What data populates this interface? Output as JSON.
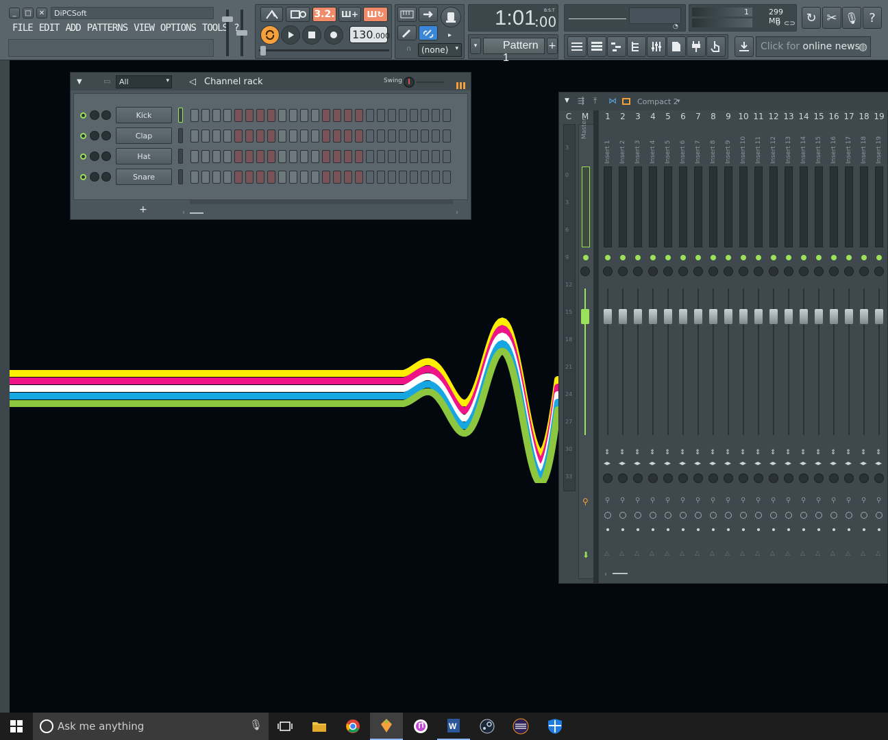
{
  "window": {
    "title": "DiPCSoft",
    "controls": [
      "_",
      "□",
      "✕"
    ]
  },
  "menu": [
    "FILE",
    "EDIT",
    "ADD",
    "PATTERNS",
    "VIEW",
    "OPTIONS",
    "TOOLS",
    "?"
  ],
  "transport": {
    "tempo": "130",
    "tempo_decimals": ".000",
    "time": "1:01",
    "time_ticks": ":00",
    "time_label": "B:S:T",
    "snap": "(none)",
    "pattern": "Pattern 1"
  },
  "cpu": {
    "voices": "1",
    "memory": "299 MB",
    "polyphony": "0"
  },
  "news": {
    "text_prefix": "Click for ",
    "text_highlight": "online news"
  },
  "channel_rack": {
    "title": "Channel rack",
    "filter": "All",
    "swing_label": "Swing",
    "add_label": "+",
    "channels": [
      {
        "name": "Kick"
      },
      {
        "name": "Clap"
      },
      {
        "name": "Hat"
      },
      {
        "name": "Snare"
      }
    ]
  },
  "mixer": {
    "preset": "Compact 2",
    "master_label": "Master",
    "c_label": "C",
    "m_label": "M",
    "tracks": [
      "1",
      "2",
      "3",
      "4",
      "5",
      "6",
      "7",
      "8",
      "9",
      "10",
      "11",
      "12",
      "13",
      "14",
      "15",
      "16",
      "17",
      "18",
      "19"
    ],
    "insert_labels": [
      "Insert 1",
      "Insert 2",
      "Insert 3",
      "Insert 4",
      "Insert 5",
      "Insert 6",
      "Insert 7",
      "Insert 8",
      "Insert 9",
      "Insert 10",
      "Insert 11",
      "Insert 12",
      "Insert 13",
      "Insert 14",
      "Insert 15",
      "Insert 16",
      "Insert 17",
      "Insert 18",
      "Insert 19"
    ],
    "db_scale": [
      "3",
      "0",
      "3",
      "6",
      "9",
      "12",
      "15",
      "18",
      "21",
      "24",
      "27",
      "30",
      "33"
    ]
  },
  "taskbar": {
    "search_placeholder": "Ask me anything"
  },
  "colors": {
    "accent_orange": "#f5a03c",
    "accent_green": "#9be25a",
    "step_active": "#7a5358",
    "step_inactive": "#6e797e",
    "wave_yellow": "#ffee00",
    "wave_pink": "#ee1488",
    "wave_white": "#ffffff",
    "wave_cyan": "#16a6e2",
    "wave_green": "#8dc63f"
  }
}
